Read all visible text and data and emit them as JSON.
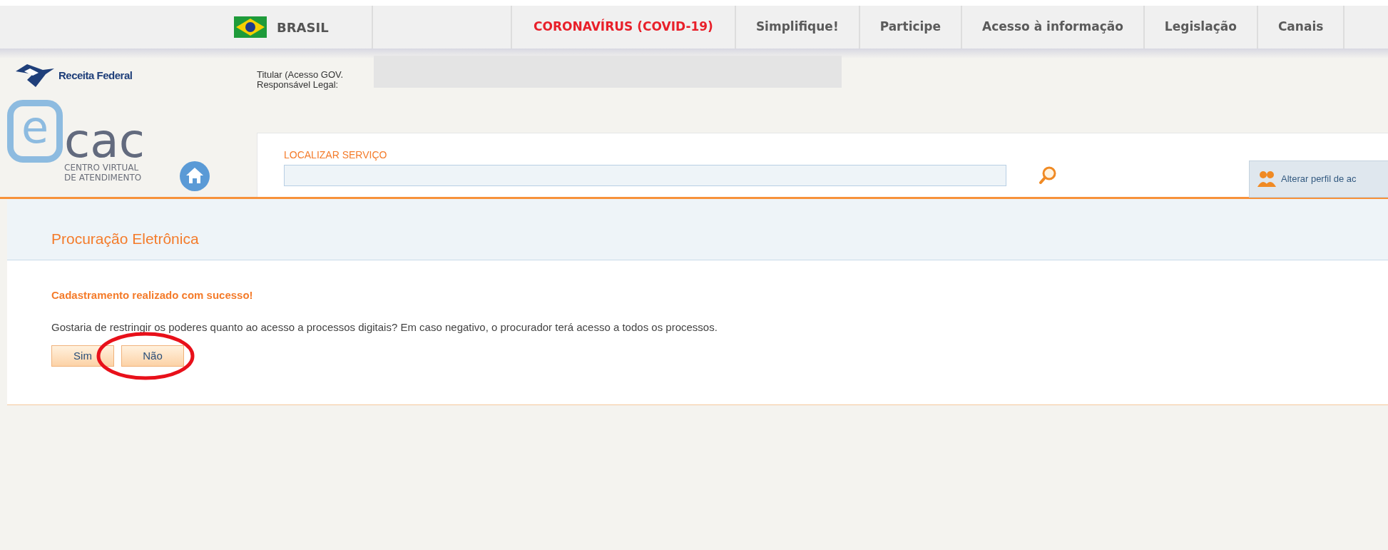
{
  "top_nav": {
    "country": "BRASIL",
    "items": [
      {
        "label": "CORONAVÍRUS (COVID-19)",
        "kind": "alert"
      },
      {
        "label": "Simplifique!",
        "kind": "normal"
      },
      {
        "label": "Participe",
        "kind": "normal"
      },
      {
        "label": "Acesso à informação",
        "kind": "normal"
      },
      {
        "label": "Legislação",
        "kind": "normal"
      },
      {
        "label": "Canais",
        "kind": "normal"
      }
    ]
  },
  "header": {
    "agency_logo": "Receita Federal",
    "user_lines": [
      "Titular (Acesso GOV.",
      "Responsável Legal:"
    ],
    "logo": {
      "mark": "e",
      "name": "cac",
      "subtitle_lines": [
        "CENTRO VIRTUAL",
        "DE ATENDIMENTO"
      ]
    }
  },
  "search": {
    "label": "LOCALIZAR SERVIÇO",
    "profile_button": "Alterar perfil de ac"
  },
  "page_title": "Procuração Eletrônica",
  "message": "Cadastramento realizado com sucesso!",
  "question": "Gostaria de restringir os poderes quanto ao acesso a processos digitais? Em caso negativo, o procurador terá acesso a todos os processos.",
  "buttons": [
    {
      "label": "Sim",
      "highlighted": false
    },
    {
      "label": "Não",
      "highlighted": true
    }
  ]
}
